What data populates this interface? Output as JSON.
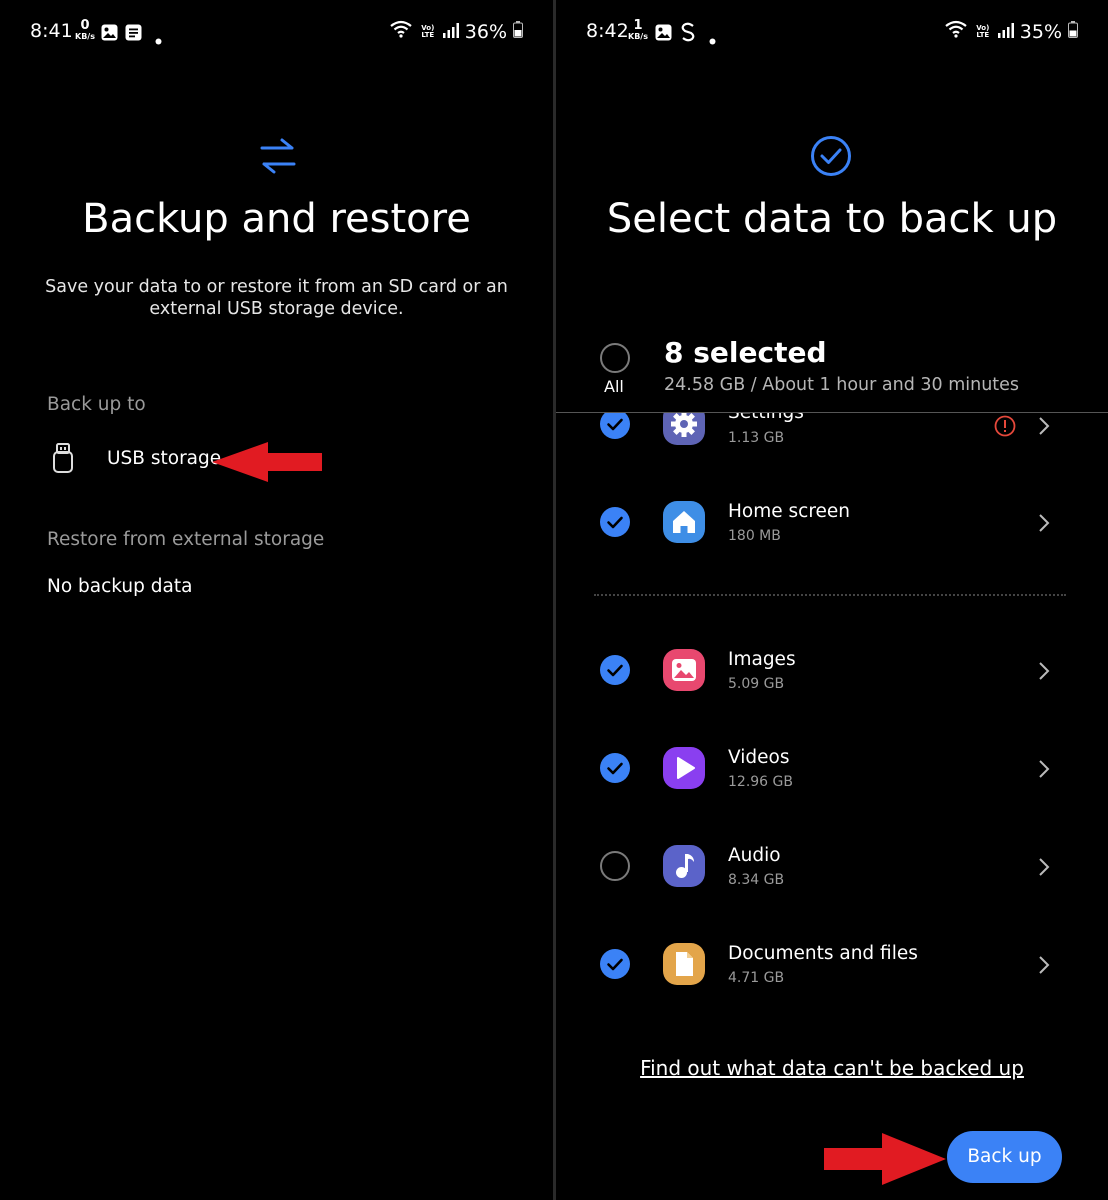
{
  "left": {
    "status": {
      "time": "8:41",
      "kbs_value": "0",
      "kbs_unit": "KB/s",
      "lte": "Vo) LTE",
      "battery": "36%"
    },
    "title": "Backup and restore",
    "description": "Save your data to or restore it from an SD card or an external USB storage device.",
    "backup_section_label": "Back up to",
    "usb_label": "USB storage",
    "restore_section_label": "Restore from external storage",
    "no_backup_label": "No backup data"
  },
  "right": {
    "status": {
      "time": "8:42",
      "kbs_value": "1",
      "kbs_unit": "KB/s",
      "lte": "Vo) LTE",
      "battery": "35%"
    },
    "title": "Select data to back up",
    "select_all_label": "All",
    "selected_count": "8 selected",
    "summary": "24.58 GB / About 1 hour and 30 minutes",
    "items": [
      {
        "title": "Settings",
        "size": "1.13 GB",
        "checked": true,
        "icon": "settings-icon",
        "warning": true
      },
      {
        "title": "Home screen",
        "size": "180 MB",
        "checked": true,
        "icon": "home-icon"
      },
      {
        "title": "Images",
        "size": "5.09 GB",
        "checked": true,
        "icon": "image-icon"
      },
      {
        "title": "Videos",
        "size": "12.96 GB",
        "checked": true,
        "icon": "play-icon"
      },
      {
        "title": "Audio",
        "size": "8.34 GB",
        "checked": false,
        "icon": "music-icon"
      },
      {
        "title": "Documents and files",
        "size": "4.71 GB",
        "checked": true,
        "icon": "document-icon"
      }
    ],
    "info_link": "Find out what data can't be backed up",
    "backup_button": "Back up"
  },
  "colors": {
    "accent": "#3b82f6",
    "arrow": "#e11b22",
    "warning": "#e5483b"
  }
}
